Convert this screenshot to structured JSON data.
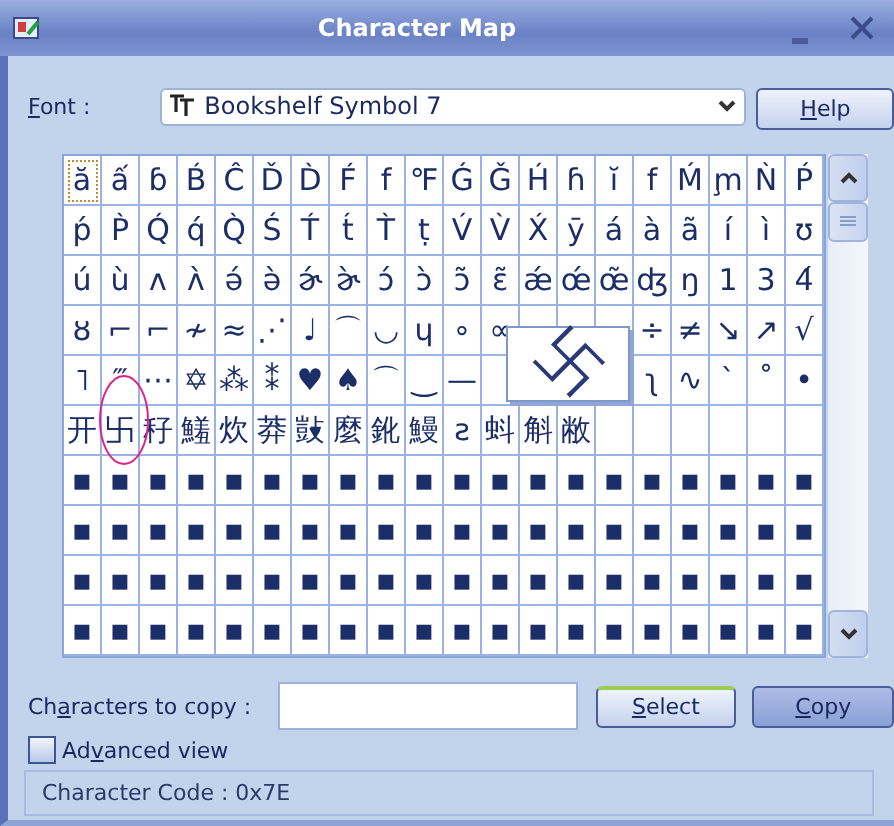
{
  "window": {
    "title": "Character Map"
  },
  "font": {
    "label": {
      "key": "F",
      "post": "ont :"
    },
    "value": "Bookshelf Symbol 7"
  },
  "help_button": {
    "key": "H",
    "post": "elp"
  },
  "grid": {
    "rows": [
      [
        {
          "ch": "ă",
          "selected": true
        },
        {
          "ch": "ấ",
          "selected": false
        },
        {
          "ch": "ɓ",
          "selected": false
        },
        {
          "ch": "B́",
          "selected": false
        },
        {
          "ch": "Ĉ",
          "selected": false
        },
        {
          "ch": "Ď",
          "selected": false
        },
        {
          "ch": "D̀",
          "selected": false
        },
        {
          "ch": "F́",
          "selected": false
        },
        {
          "ch": "f",
          "selected": false
        },
        {
          "ch": "℉",
          "selected": false
        },
        {
          "ch": "Ǵ",
          "selected": false
        },
        {
          "ch": "Ǧ",
          "selected": false
        },
        {
          "ch": "H́",
          "selected": false
        },
        {
          "ch": "ɦ",
          "selected": false
        },
        {
          "ch": "ĭ",
          "selected": false
        },
        {
          "ch": "f",
          "selected": false
        },
        {
          "ch": "Ḿ",
          "selected": false
        },
        {
          "ch": "m̧",
          "selected": false
        },
        {
          "ch": "Ǹ",
          "selected": false
        },
        {
          "ch": "Ṕ",
          "selected": false
        }
      ],
      [
        {
          "ch": "ṕ",
          "selected": false
        },
        {
          "ch": "P̀",
          "selected": false
        },
        {
          "ch": "Q́",
          "selected": false
        },
        {
          "ch": "q́",
          "selected": false
        },
        {
          "ch": "Q̀",
          "selected": false
        },
        {
          "ch": "Ś",
          "selected": false
        },
        {
          "ch": "T́",
          "selected": false
        },
        {
          "ch": "t́",
          "selected": false
        },
        {
          "ch": "T̀",
          "selected": false
        },
        {
          "ch": "ṭ",
          "selected": false
        },
        {
          "ch": "V́",
          "selected": false
        },
        {
          "ch": "V̀",
          "selected": false
        },
        {
          "ch": "X́",
          "selected": false
        },
        {
          "ch": "ȳ",
          "selected": false
        },
        {
          "ch": "á",
          "selected": false
        },
        {
          "ch": "à",
          "selected": false
        },
        {
          "ch": "ã",
          "selected": false
        },
        {
          "ch": "í",
          "selected": false
        },
        {
          "ch": "ì",
          "selected": false
        },
        {
          "ch": "ʊ",
          "selected": false
        }
      ],
      [
        {
          "ch": "ú",
          "selected": false
        },
        {
          "ch": "ù",
          "selected": false
        },
        {
          "ch": "ʌ",
          "selected": false
        },
        {
          "ch": "ʌ̀",
          "selected": false
        },
        {
          "ch": "ə́",
          "selected": false
        },
        {
          "ch": "ə̀",
          "selected": false
        },
        {
          "ch": "ɚ́",
          "selected": false
        },
        {
          "ch": "ɚ̀",
          "selected": false
        },
        {
          "ch": "ɔ́",
          "selected": false
        },
        {
          "ch": "ɔ̀",
          "selected": false
        },
        {
          "ch": "ɔ̃",
          "selected": false
        },
        {
          "ch": "ɛ̃",
          "selected": false
        },
        {
          "ch": "ǽ",
          "selected": false
        },
        {
          "ch": "œ́",
          "selected": false
        },
        {
          "ch": "œ̃",
          "selected": false
        },
        {
          "ch": "ʤ",
          "selected": false
        },
        {
          "ch": "ŋ",
          "selected": false
        },
        {
          "ch": "1",
          "selected": false
        },
        {
          "ch": "3",
          "selected": false
        },
        {
          "ch": "4́",
          "selected": false
        }
      ],
      [
        {
          "ch": "ȣ",
          "selected": false
        },
        {
          "ch": "⌐",
          "selected": false
        },
        {
          "ch": "⌐",
          "selected": false
        },
        {
          "ch": "≁",
          "selected": false
        },
        {
          "ch": "≈",
          "selected": false
        },
        {
          "ch": "⋰",
          "selected": false
        },
        {
          "ch": "♩",
          "selected": false
        },
        {
          "ch": "⌒",
          "selected": false
        },
        {
          "ch": "◡",
          "selected": false
        },
        {
          "ch": "ɥ",
          "selected": false
        },
        {
          "ch": "∘",
          "selected": false
        },
        {
          "ch": "∝",
          "selected": false
        },
        {
          "selected": false
        },
        {
          "selected": false
        },
        {
          "selected": false
        },
        {
          "ch": "÷",
          "selected": false
        },
        {
          "ch": "≠",
          "selected": false
        },
        {
          "ch": "↘",
          "selected": false
        },
        {
          "ch": "↗",
          "selected": false
        },
        {
          "ch": "√",
          "selected": false
        }
      ],
      [
        {
          "ch": "˥",
          "selected": false
        },
        {
          "ch": "‴",
          "selected": false
        },
        {
          "ch": "⋯",
          "selected": false
        },
        {
          "ch": "✡",
          "selected": false
        },
        {
          "ch": "⁂",
          "selected": false
        },
        {
          "ch": "⁑",
          "selected": false
        },
        {
          "ch": "♥",
          "selected": false
        },
        {
          "ch": "♠",
          "selected": false
        },
        {
          "ch": "⌒",
          "selected": false
        },
        {
          "ch": "‿",
          "selected": false
        },
        {
          "ch": "—",
          "selected": false
        },
        {
          "selected": false
        },
        null,
        null,
        null,
        {
          "ch": "ʅ",
          "selected": false
        },
        {
          "ch": "∿",
          "selected": false
        },
        {
          "ch": "ˋ",
          "selected": false
        },
        {
          "ch": "˚",
          "selected": false
        },
        {
          "ch": "•",
          "selected": false
        }
      ],
      [
        {
          "ch": "开",
          "selected": false
        },
        {
          "ch": "卐",
          "selected": false
        },
        {
          "ch": "秄",
          "selected": false
        },
        {
          "ch": "鱃",
          "selected": false
        },
        {
          "ch": "炊",
          "selected": false
        },
        {
          "ch": "莽",
          "selected": false
        },
        {
          "ch": "敱",
          "selected": false
        },
        {
          "ch": "麼",
          "selected": false
        },
        {
          "ch": "鈋",
          "selected": false
        },
        {
          "ch": "鰻",
          "selected": false
        },
        {
          "ch": "ƨ",
          "selected": false
        },
        {
          "ch": "蚪",
          "selected": false
        },
        {
          "ch": "斛",
          "selected": false
        },
        {
          "ch": "敝",
          "selected": false
        },
        {
          "selected": false
        },
        {
          "selected": false
        },
        {
          "selected": false
        },
        {
          "selected": false
        },
        {
          "selected": false
        },
        {
          "selected": false
        }
      ],
      [
        {
          "ch": "▪",
          "selected": false
        },
        {
          "ch": "▪",
          "selected": false
        },
        {
          "ch": "▪",
          "selected": false
        },
        {
          "ch": "▪",
          "selected": false
        },
        {
          "ch": "▪",
          "selected": false
        },
        {
          "ch": "▪",
          "selected": false
        },
        {
          "ch": "▪",
          "selected": false
        },
        {
          "ch": "▪",
          "selected": false
        },
        {
          "ch": "▪",
          "selected": false
        },
        {
          "ch": "▪",
          "selected": false
        },
        {
          "ch": "▪",
          "selected": false
        },
        {
          "ch": "▪",
          "selected": false
        },
        {
          "ch": "▪",
          "selected": false
        },
        {
          "ch": "▪",
          "selected": false
        },
        {
          "ch": "▪",
          "selected": false
        },
        {
          "ch": "▪",
          "selected": false
        },
        {
          "ch": "▪",
          "selected": false
        },
        {
          "ch": "▪",
          "selected": false
        },
        {
          "ch": "▪",
          "selected": false
        },
        {
          "ch": "▪",
          "selected": false
        }
      ],
      [
        {
          "ch": "▪",
          "selected": false
        },
        {
          "ch": "▪",
          "selected": false
        },
        {
          "ch": "▪",
          "selected": false
        },
        {
          "ch": "▪",
          "selected": false
        },
        {
          "ch": "▪",
          "selected": false
        },
        {
          "ch": "▪",
          "selected": false
        },
        {
          "ch": "▪",
          "selected": false
        },
        {
          "ch": "▪",
          "selected": false
        },
        {
          "ch": "▪",
          "selected": false
        },
        {
          "ch": "▪",
          "selected": false
        },
        {
          "ch": "▪",
          "selected": false
        },
        {
          "ch": "▪",
          "selected": false
        },
        {
          "ch": "▪",
          "selected": false
        },
        {
          "ch": "▪",
          "selected": false
        },
        {
          "ch": "▪",
          "selected": false
        },
        {
          "ch": "▪",
          "selected": false
        },
        {
          "ch": "▪",
          "selected": false
        },
        {
          "ch": "▪",
          "selected": false
        },
        {
          "ch": "▪",
          "selected": false
        },
        {
          "ch": "▪",
          "selected": false
        }
      ],
      [
        {
          "ch": "▪",
          "selected": false
        },
        {
          "ch": "▪",
          "selected": false
        },
        {
          "ch": "▪",
          "selected": false
        },
        {
          "ch": "▪",
          "selected": false
        },
        {
          "ch": "▪",
          "selected": false
        },
        {
          "ch": "▪",
          "selected": false
        },
        {
          "ch": "▪",
          "selected": false
        },
        {
          "ch": "▪",
          "selected": false
        },
        {
          "ch": "▪",
          "selected": false
        },
        {
          "ch": "▪",
          "selected": false
        },
        {
          "ch": "▪",
          "selected": false
        },
        {
          "ch": "▪",
          "selected": false
        },
        {
          "ch": "▪",
          "selected": false
        },
        {
          "ch": "▪",
          "selected": false
        },
        {
          "ch": "▪",
          "selected": false
        },
        {
          "ch": "▪",
          "selected": false
        },
        {
          "ch": "▪",
          "selected": false
        },
        {
          "ch": "▪",
          "selected": false
        },
        {
          "ch": "▪",
          "selected": false
        },
        {
          "ch": "▪",
          "selected": false
        }
      ],
      [
        {
          "ch": "▪",
          "selected": false
        },
        {
          "ch": "▪",
          "selected": false
        },
        {
          "ch": "▪",
          "selected": false
        },
        {
          "ch": "▪",
          "selected": false
        },
        {
          "ch": "▪",
          "selected": false
        },
        {
          "ch": "▪",
          "selected": false
        },
        {
          "ch": "▪",
          "selected": false
        },
        {
          "ch": "▪",
          "selected": false
        },
        {
          "ch": "▪",
          "selected": false
        },
        {
          "ch": "▪",
          "selected": false
        },
        {
          "ch": "▪",
          "selected": false
        },
        {
          "ch": "▪",
          "selected": false
        },
        {
          "ch": "▪",
          "selected": false
        },
        {
          "ch": "▪",
          "selected": false
        },
        {
          "ch": "▪",
          "selected": false
        },
        {
          "ch": "▪",
          "selected": false
        },
        {
          "ch": "▪",
          "selected": false
        },
        {
          "ch": "▪",
          "selected": false
        },
        {
          "ch": "▪",
          "selected": false
        },
        {
          "ch": "▪",
          "selected": false
        }
      ]
    ],
    "magnified": {
      "ch": "卐"
    }
  },
  "copy_label": {
    "pre": "Ch",
    "key": "a",
    "post": "racters to copy :"
  },
  "select_button": {
    "key": "S",
    "post": "elect"
  },
  "copy_button": {
    "key": "C",
    "post": "opy"
  },
  "advanced_view": {
    "pre": "Ad",
    "key": "v",
    "post": "anced view",
    "checked": false
  },
  "status_bar": "Character Code : 0x7E"
}
